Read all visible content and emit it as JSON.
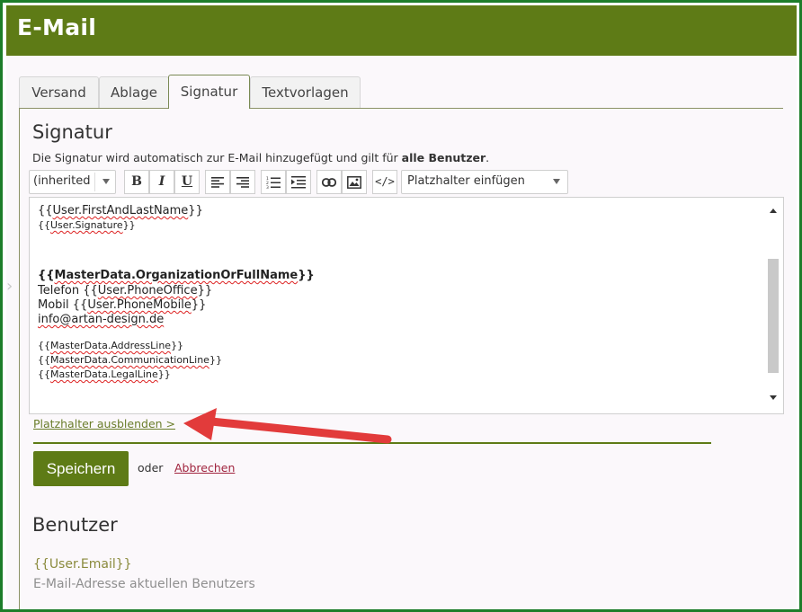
{
  "window": {
    "title": "E-Mail"
  },
  "tabs": [
    {
      "label": "Versand"
    },
    {
      "label": "Ablage"
    },
    {
      "label": "Signatur",
      "active": true
    },
    {
      "label": "Textvorlagen"
    }
  ],
  "signature": {
    "heading": "Signatur",
    "description_prefix": "Die Signatur wird automatisch zur E-Mail hinzugefügt und gilt für ",
    "description_bold": "alle Benutzer",
    "description_suffix": "."
  },
  "toolbar": {
    "font_select": "(inherited",
    "bold": "B",
    "italic": "I",
    "underline": "U",
    "placeholder_select": "Platzhalter einfügen"
  },
  "editor": {
    "first_name_line": {
      "pre": "{{",
      "word": "User.FirstAndLastName",
      "post": "}}"
    },
    "signature_line": {
      "pre": "{{",
      "word": "User.Signature",
      "post": "}}"
    },
    "org_line": {
      "pre": "{{",
      "word": "MasterData.OrganizationOrFullName",
      "post": "}}"
    },
    "phone_line": {
      "label": "Telefon ",
      "pre": "{{",
      "word": "User.PhoneOffice",
      "post": "}}"
    },
    "mobile_line": {
      "label": "Mobil ",
      "pre": "{{",
      "word": "User.PhoneMobile",
      "post": "}}"
    },
    "email_line": {
      "text": "info@artan-design.de"
    },
    "address_line": {
      "pre": "{{",
      "word": "MasterData.AddressLine",
      "post": "}}"
    },
    "communication_line": {
      "pre": "{{",
      "word": "MasterData.CommunicationLine",
      "post": "}}"
    },
    "legal_line": {
      "pre": "{{",
      "word": "MasterData.LegalLine",
      "post": "}}"
    }
  },
  "actions": {
    "toggle_placeholders": "Platzhalter ausblenden >",
    "save": "Speichern",
    "or": "oder",
    "cancel": "Abbrechen"
  },
  "users": {
    "heading": "Benutzer",
    "placeholder": "{{User.Email}}",
    "placeholder_description": "E-Mail-Adresse aktuellen Benutzers"
  },
  "colors": {
    "brand_green": "#5e7b16",
    "outer_border": "#1d7d2a",
    "annotation_arrow": "#e23b3b",
    "cancel_link": "#a0243e"
  }
}
